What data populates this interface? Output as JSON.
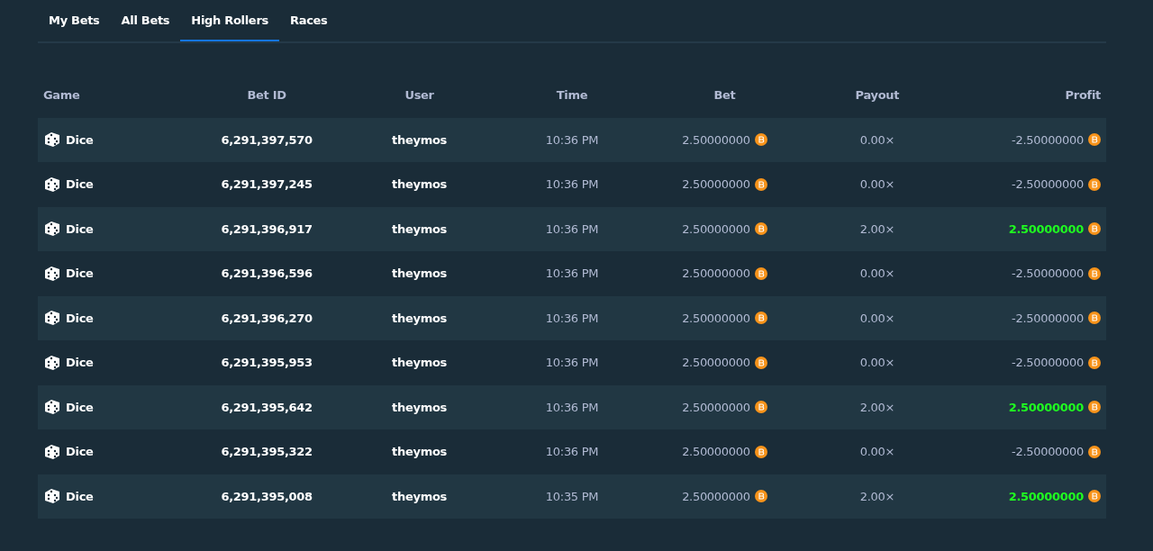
{
  "tabs": [
    {
      "label": "My Bets",
      "selected": false
    },
    {
      "label": "All Bets",
      "selected": false
    },
    {
      "label": "High Rollers",
      "selected": true
    },
    {
      "label": "Races",
      "selected": false
    }
  ],
  "table": {
    "columns": [
      "Game",
      "Bet ID",
      "User",
      "Time",
      "Bet",
      "Payout",
      "Profit"
    ],
    "rows": [
      {
        "game": "Dice",
        "bet_id": "6,291,397,570",
        "user": "theymos",
        "time": "10:36 PM",
        "bet": "2.50000000",
        "payout": "0.00×",
        "profit": "-2.50000000",
        "win": false
      },
      {
        "game": "Dice",
        "bet_id": "6,291,397,245",
        "user": "theymos",
        "time": "10:36 PM",
        "bet": "2.50000000",
        "payout": "0.00×",
        "profit": "-2.50000000",
        "win": false
      },
      {
        "game": "Dice",
        "bet_id": "6,291,396,917",
        "user": "theymos",
        "time": "10:36 PM",
        "bet": "2.50000000",
        "payout": "2.00×",
        "profit": "2.50000000",
        "win": true
      },
      {
        "game": "Dice",
        "bet_id": "6,291,396,596",
        "user": "theymos",
        "time": "10:36 PM",
        "bet": "2.50000000",
        "payout": "0.00×",
        "profit": "-2.50000000",
        "win": false
      },
      {
        "game": "Dice",
        "bet_id": "6,291,396,270",
        "user": "theymos",
        "time": "10:36 PM",
        "bet": "2.50000000",
        "payout": "0.00×",
        "profit": "-2.50000000",
        "win": false
      },
      {
        "game": "Dice",
        "bet_id": "6,291,395,953",
        "user": "theymos",
        "time": "10:36 PM",
        "bet": "2.50000000",
        "payout": "0.00×",
        "profit": "-2.50000000",
        "win": false
      },
      {
        "game": "Dice",
        "bet_id": "6,291,395,642",
        "user": "theymos",
        "time": "10:36 PM",
        "bet": "2.50000000",
        "payout": "2.00×",
        "profit": "2.50000000",
        "win": true
      },
      {
        "game": "Dice",
        "bet_id": "6,291,395,322",
        "user": "theymos",
        "time": "10:36 PM",
        "bet": "2.50000000",
        "payout": "0.00×",
        "profit": "-2.50000000",
        "win": false
      },
      {
        "game": "Dice",
        "bet_id": "6,291,395,008",
        "user": "theymos",
        "time": "10:35 PM",
        "bet": "2.50000000",
        "payout": "2.00×",
        "profit": "2.50000000",
        "win": true
      }
    ]
  }
}
